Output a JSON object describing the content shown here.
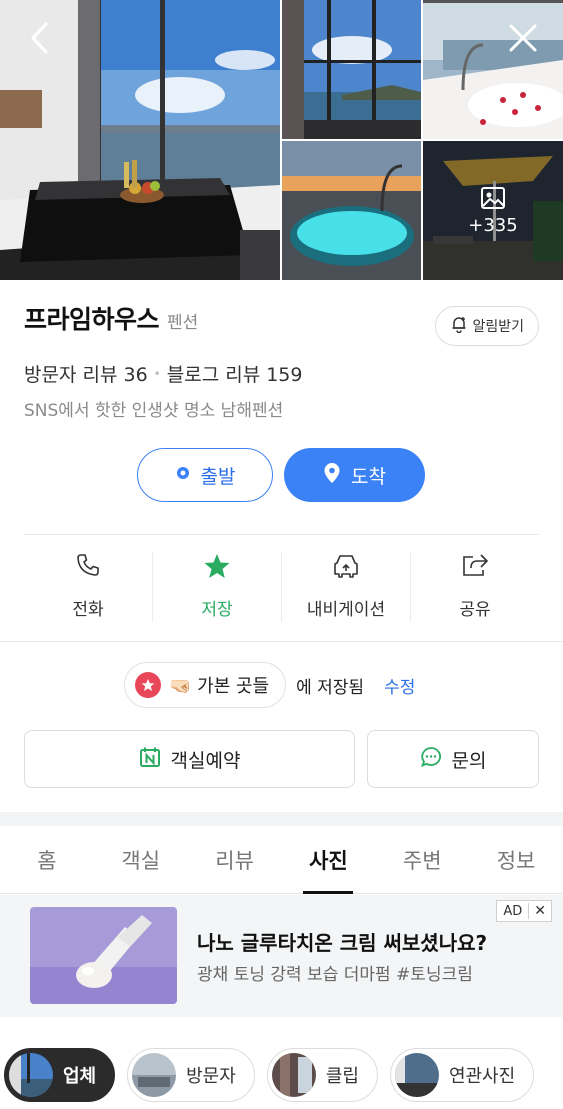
{
  "gallery": {
    "more_count": "+335",
    "icons": {
      "back": "chevron-left-icon",
      "close": "close-icon",
      "more": "image-icon"
    }
  },
  "place": {
    "name": "프라임하우스",
    "category": "펜션",
    "notify_label": "알림받기",
    "visitor_reviews": "방문자 리뷰 36",
    "blog_reviews": "블로그 리뷰 159",
    "description": "SNS에서 핫한 인생샷 명소 남해펜션"
  },
  "route": {
    "depart_label": "출발",
    "arrive_label": "도착",
    "accent": "#3b82f6"
  },
  "actions": [
    {
      "label": "전화",
      "icon": "phone-icon"
    },
    {
      "label": "저장",
      "icon": "star-icon",
      "active_color": "#2aab62"
    },
    {
      "label": "내비게이션",
      "icon": "navigation-icon"
    },
    {
      "label": "공유",
      "icon": "share-icon"
    }
  ],
  "saved": {
    "list_name": "🤜🏻 가본 곳들",
    "saved_text": "에 저장됨",
    "edit_label": "수정"
  },
  "booking": {
    "book_label": "객실예약",
    "inquiry_label": "문의"
  },
  "tabs": [
    {
      "label": "홈"
    },
    {
      "label": "객실"
    },
    {
      "label": "리뷰"
    },
    {
      "label": "사진",
      "active": true
    },
    {
      "label": "주변"
    },
    {
      "label": "정보"
    }
  ],
  "ad": {
    "badge": "AD",
    "close": "✕",
    "title": "나노 글루타치온 크림 써보셨나요?",
    "subtitle": "광채 토닝 강력 보습 더마펌 #토닝크림"
  },
  "filters": [
    {
      "label": "업체",
      "active": true
    },
    {
      "label": "방문자"
    },
    {
      "label": "클립"
    },
    {
      "label": "연관사진"
    }
  ]
}
